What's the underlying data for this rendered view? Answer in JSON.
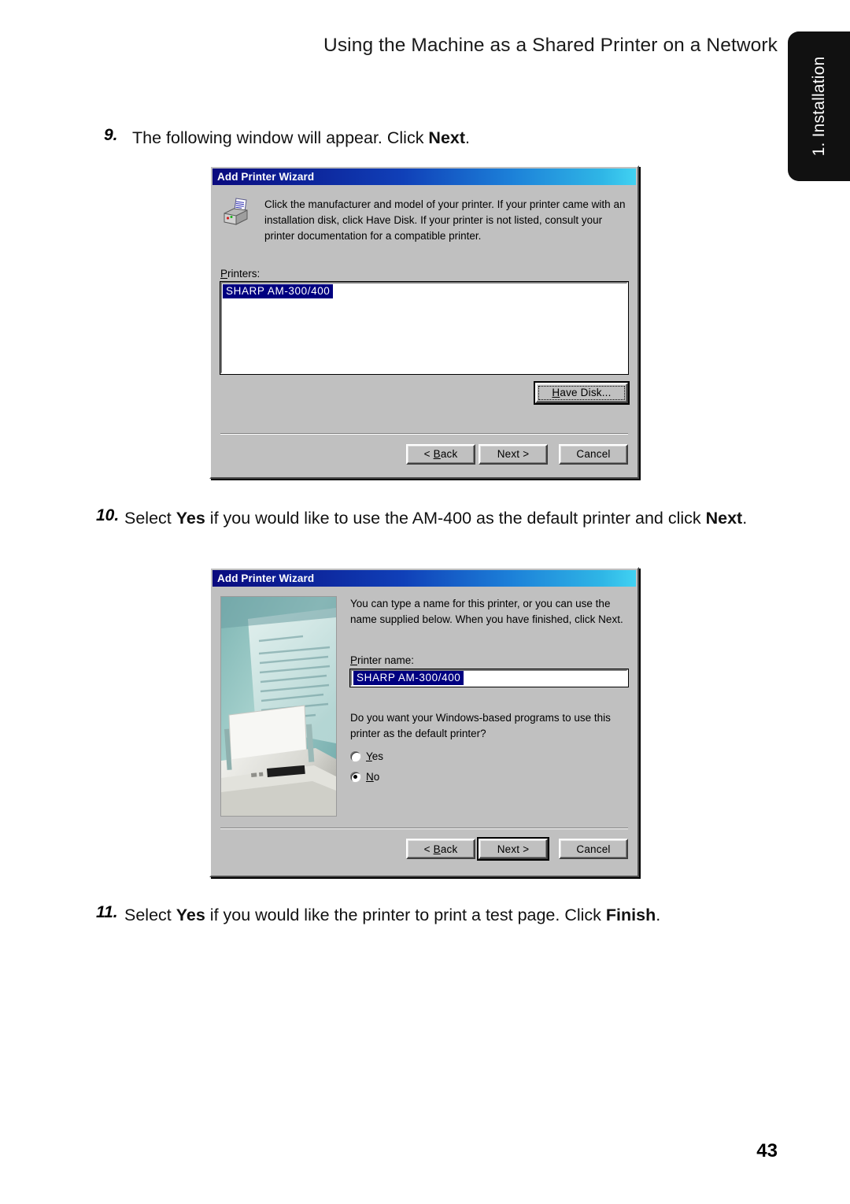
{
  "header": {
    "title": "Using the Machine as a Shared Printer on a Network"
  },
  "side_tab": {
    "label": "1. Installation",
    "color": "#111111"
  },
  "steps": [
    {
      "number": "9.",
      "text_before": "The following window will appear. Click ",
      "bold": "Next",
      "text_after": "."
    },
    {
      "number": "10.",
      "text_before": "Select ",
      "bold": "Yes",
      "text_mid": " if you would like to use the AM-400 as the default printer and click ",
      "bold2": "Next",
      "text_after": "."
    },
    {
      "number": "11.",
      "text_before": "Select ",
      "bold": "Yes",
      "text_mid": " if you would like the printer to print a test page. Click ",
      "bold2": "Finish",
      "text_after": "."
    }
  ],
  "dialog1": {
    "title": "Add Printer Wizard",
    "icon": "printer-icon",
    "intro": "Click the manufacturer and model of your printer. If your printer came with an installation disk, click Have Disk. If your printer is not listed, consult your printer documentation for a compatible printer.",
    "printers_label": "Printers:",
    "printers_label_mnemonic": "P",
    "printer_list": [
      "SHARP AM-300/400"
    ],
    "selected_printer": "SHARP AM-300/400",
    "have_disk_label": "Have Disk...",
    "have_disk_mnemonic": "H",
    "buttons": {
      "back": "< Back",
      "back_mnemonic": "B",
      "next": "Next >",
      "cancel": "Cancel"
    },
    "default_button": "have_disk",
    "titlebar_gradient_start": "#0a0a7e",
    "titlebar_gradient_end": "#41d2f2"
  },
  "dialog2": {
    "title": "Add Printer Wizard",
    "image_alt": "printer-photo",
    "intro": "You can type a name for this printer, or you can use the name supplied below. When you have finished, click Next.",
    "printer_name_label": "Printer name:",
    "printer_name_mnemonic": "P",
    "printer_name_value": "SHARP AM-300/400",
    "question": "Do you want your Windows-based programs to use this printer as the default printer?",
    "radios": [
      {
        "label": "Yes",
        "mnemonic": "Y",
        "checked": false
      },
      {
        "label": "No",
        "mnemonic": "N",
        "checked": true
      }
    ],
    "buttons": {
      "back": "< Back",
      "back_mnemonic": "B",
      "next": "Next >",
      "cancel": "Cancel"
    },
    "default_button": "next"
  },
  "footer": {
    "page_number": "43"
  }
}
